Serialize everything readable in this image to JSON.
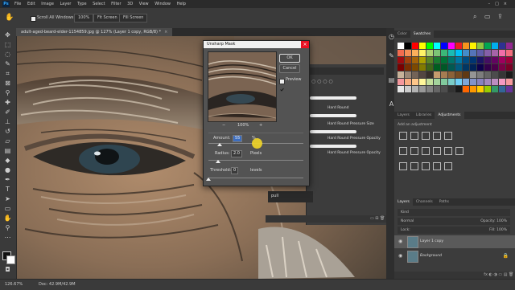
{
  "app": {
    "logo": "Ps"
  },
  "menu": [
    "File",
    "Edit",
    "Image",
    "Layer",
    "Type",
    "Select",
    "Filter",
    "3D",
    "View",
    "Window",
    "Help"
  ],
  "window_controls": [
    "–",
    "□",
    "×"
  ],
  "options": {
    "tool_icon": "hand-icon",
    "scroll_all_label": "Scroll All Windows",
    "zoom_100": "100%",
    "fit_screen": "Fit Screen",
    "fill_screen": "Fill Screen"
  },
  "document": {
    "tab_title": "adult-aged-beard-elder-1154859.jpg @ 127% (Layer 1 copy, RGB/8) *",
    "tab_close": "×"
  },
  "status": {
    "zoom": "126.67%",
    "doc": "Doc: 42.9M/42.9M"
  },
  "dialog": {
    "title": "Unsharp Mask",
    "close": "×",
    "ok": "OK",
    "cancel": "Cancel",
    "preview_label": "Preview",
    "preview_checked": true,
    "zoom": "100%",
    "zoom_out": "−",
    "zoom_in": "+",
    "amount_label": "Amount:",
    "amount_value": "55",
    "amount_unit": "%",
    "amount_fraction": 0.12,
    "radius_label": "Radius:",
    "radius_value": "2.0",
    "radius_unit": "Pixels",
    "radius_fraction": 0.1,
    "threshold_label": "Threshold:",
    "threshold_value": "0",
    "threshold_unit": "levels",
    "threshold_fraction": 0.0
  },
  "brushes": {
    "items": [
      "Hard Round",
      "Hard Round Pressure Size",
      "Hard Round Pressure Opacity",
      "Hard Round Pressure Opacity"
    ],
    "current": "pull"
  },
  "swatches": {
    "tabs": [
      "Color",
      "Swatches"
    ],
    "active": 1,
    "colors": [
      "#ffffff",
      "#000000",
      "#ff0000",
      "#ffff00",
      "#00ff00",
      "#00ffff",
      "#0000ff",
      "#ff00ff",
      "#ed1c24",
      "#f7941d",
      "#fff200",
      "#8dc63f",
      "#00a651",
      "#00aeef",
      "#2e3192",
      "#92278f",
      "#f26c4f",
      "#f68e55",
      "#fbaf5c",
      "#fff467",
      "#acd372",
      "#7cc576",
      "#3bb878",
      "#1abbb4",
      "#00bff3",
      "#438cca",
      "#5574b9",
      "#605ca8",
      "#855fa8",
      "#a763a8",
      "#f06ea9",
      "#f26d7d",
      "#9e0b0f",
      "#a0410d",
      "#a36209",
      "#aba000",
      "#598527",
      "#1a7b30",
      "#007236",
      "#00746b",
      "#0076a3",
      "#004b80",
      "#003471",
      "#1b1464",
      "#440e62",
      "#630460",
      "#9e005d",
      "#9e0039",
      "#790000",
      "#7b2e00",
      "#7d4900",
      "#827b00",
      "#406618",
      "#005e20",
      "#005826",
      "#005952",
      "#005b7f",
      "#003663",
      "#002157",
      "#0d004c",
      "#32004b",
      "#4b0049",
      "#7b0046",
      "#7a0026",
      "#c7b299",
      "#998675",
      "#736357",
      "#534741",
      "#37302a",
      "#c69c6d",
      "#a67c52",
      "#8c6239",
      "#754c24",
      "#603913",
      "#959595",
      "#7d7d7d",
      "#656565",
      "#4c4c4c",
      "#363636",
      "#1b1b1b",
      "#f5989d",
      "#f9ad81",
      "#fdc68a",
      "#fff79a",
      "#c4df9b",
      "#a3d39c",
      "#82ca9d",
      "#7bcdc8",
      "#6ecff6",
      "#7ea7d8",
      "#8493ca",
      "#8882be",
      "#a187be",
      "#bc8dbf",
      "#f49ac2",
      "#f6989d",
      "#e6e6e6",
      "#cccccc",
      "#b3b3b3",
      "#999999",
      "#808080",
      "#666666",
      "#4d4d4d",
      "#333333",
      "#1a1a1a",
      "#ff6600",
      "#ff9900",
      "#ffcc00",
      "#99cc00",
      "#339966",
      "#336699",
      "#663399"
    ]
  },
  "adjustments": {
    "tabs": [
      "Layers",
      "Libraries",
      "Adjustments"
    ],
    "active": 2,
    "hint": "Add an adjustment"
  },
  "layers": {
    "tabs": [
      "Layers",
      "Channels",
      "Paths"
    ],
    "kind": "Kind",
    "blend": "Normal",
    "opacity": "Opacity: 100%",
    "lock": "Lock:",
    "fill": "Fill: 100%",
    "items": [
      {
        "name": "Layer 1 copy"
      },
      {
        "name": "Background"
      }
    ],
    "footer": "fx ◐ ◑ ▭ ▤ 🗑"
  }
}
